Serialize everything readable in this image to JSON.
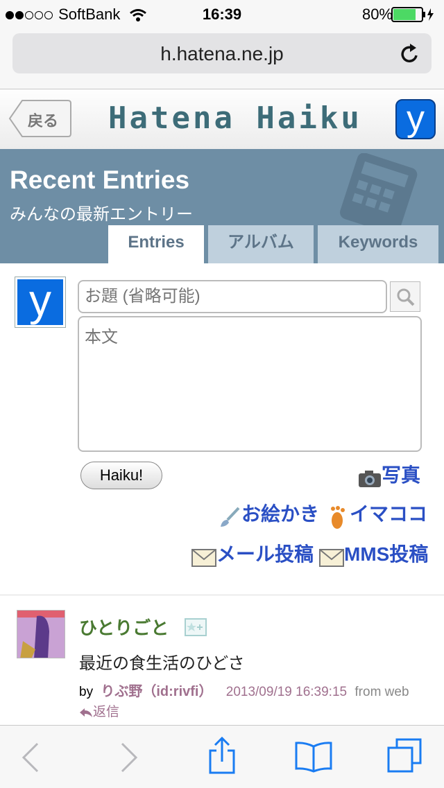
{
  "status_bar": {
    "carrier": "SoftBank",
    "time": "16:39",
    "battery": "80%"
  },
  "browser": {
    "url": "h.hatena.ne.jp"
  },
  "header": {
    "back_label": "戻る",
    "logo_text": "Hatena Haiku",
    "y_icon_label": "y"
  },
  "band": {
    "title": "Recent Entries",
    "subtitle": "みんなの最新エントリー",
    "tabs": [
      {
        "label": "Entries"
      },
      {
        "label": "アルバム"
      },
      {
        "label": "Keywords"
      }
    ],
    "active_tab": 0
  },
  "post_form": {
    "avatar_label": "y",
    "title_placeholder": "お題 (省略可能)",
    "body_placeholder": "本文",
    "submit_label": "Haiku!",
    "photo_label": "写真",
    "draw_label": "お絵かき",
    "imacoco_label": "イマココ",
    "mail_label": "メール投稿",
    "mms_label": "MMS投稿"
  },
  "entry": {
    "title": "ひとりごと",
    "body": "最近の食生活のひどさ",
    "by_label": "by",
    "author": "りぶ野（id:rivfi）",
    "timestamp": "2013/09/19 16:39:15",
    "source": "from web",
    "reply_label": "返信"
  },
  "colors": {
    "band": "#6e8ea5",
    "accent_link": "#2a4fc4",
    "entry_title": "#4a7a32",
    "meta": "#a0708e",
    "ios_blue": "#1a7cf2"
  }
}
